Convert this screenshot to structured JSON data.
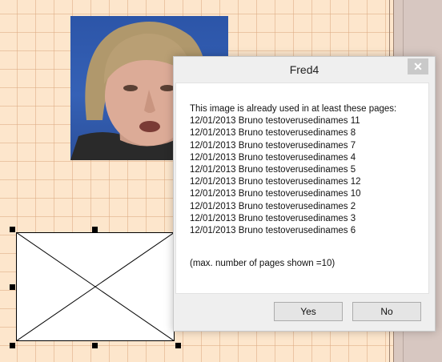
{
  "dialog": {
    "title": "Fred4",
    "close_glyph": "✕",
    "message_heading": "This image is already used in at least these pages:",
    "pages": [
      "12/01/2013 Bruno testoverusedinames 11",
      "12/01/2013 Bruno testoverusedinames 8",
      "12/01/2013 Bruno testoverusedinames 7",
      "12/01/2013 Bruno testoverusedinames 4",
      "12/01/2013 Bruno testoverusedinames 5",
      "12/01/2013 Bruno testoverusedinames 12",
      "12/01/2013 Bruno testoverusedinames 10",
      "12/01/2013 Bruno testoverusedinames 2",
      "12/01/2013 Bruno testoverusedinames 3",
      "12/01/2013 Bruno testoverusedinames 6"
    ],
    "note": "(max. number of pages shown =10)",
    "yes_label": "Yes",
    "no_label": "No"
  },
  "colors": {
    "canvas": "#fde6cc",
    "grid": "#dcaa82",
    "photo_background": "#2c55a8"
  }
}
